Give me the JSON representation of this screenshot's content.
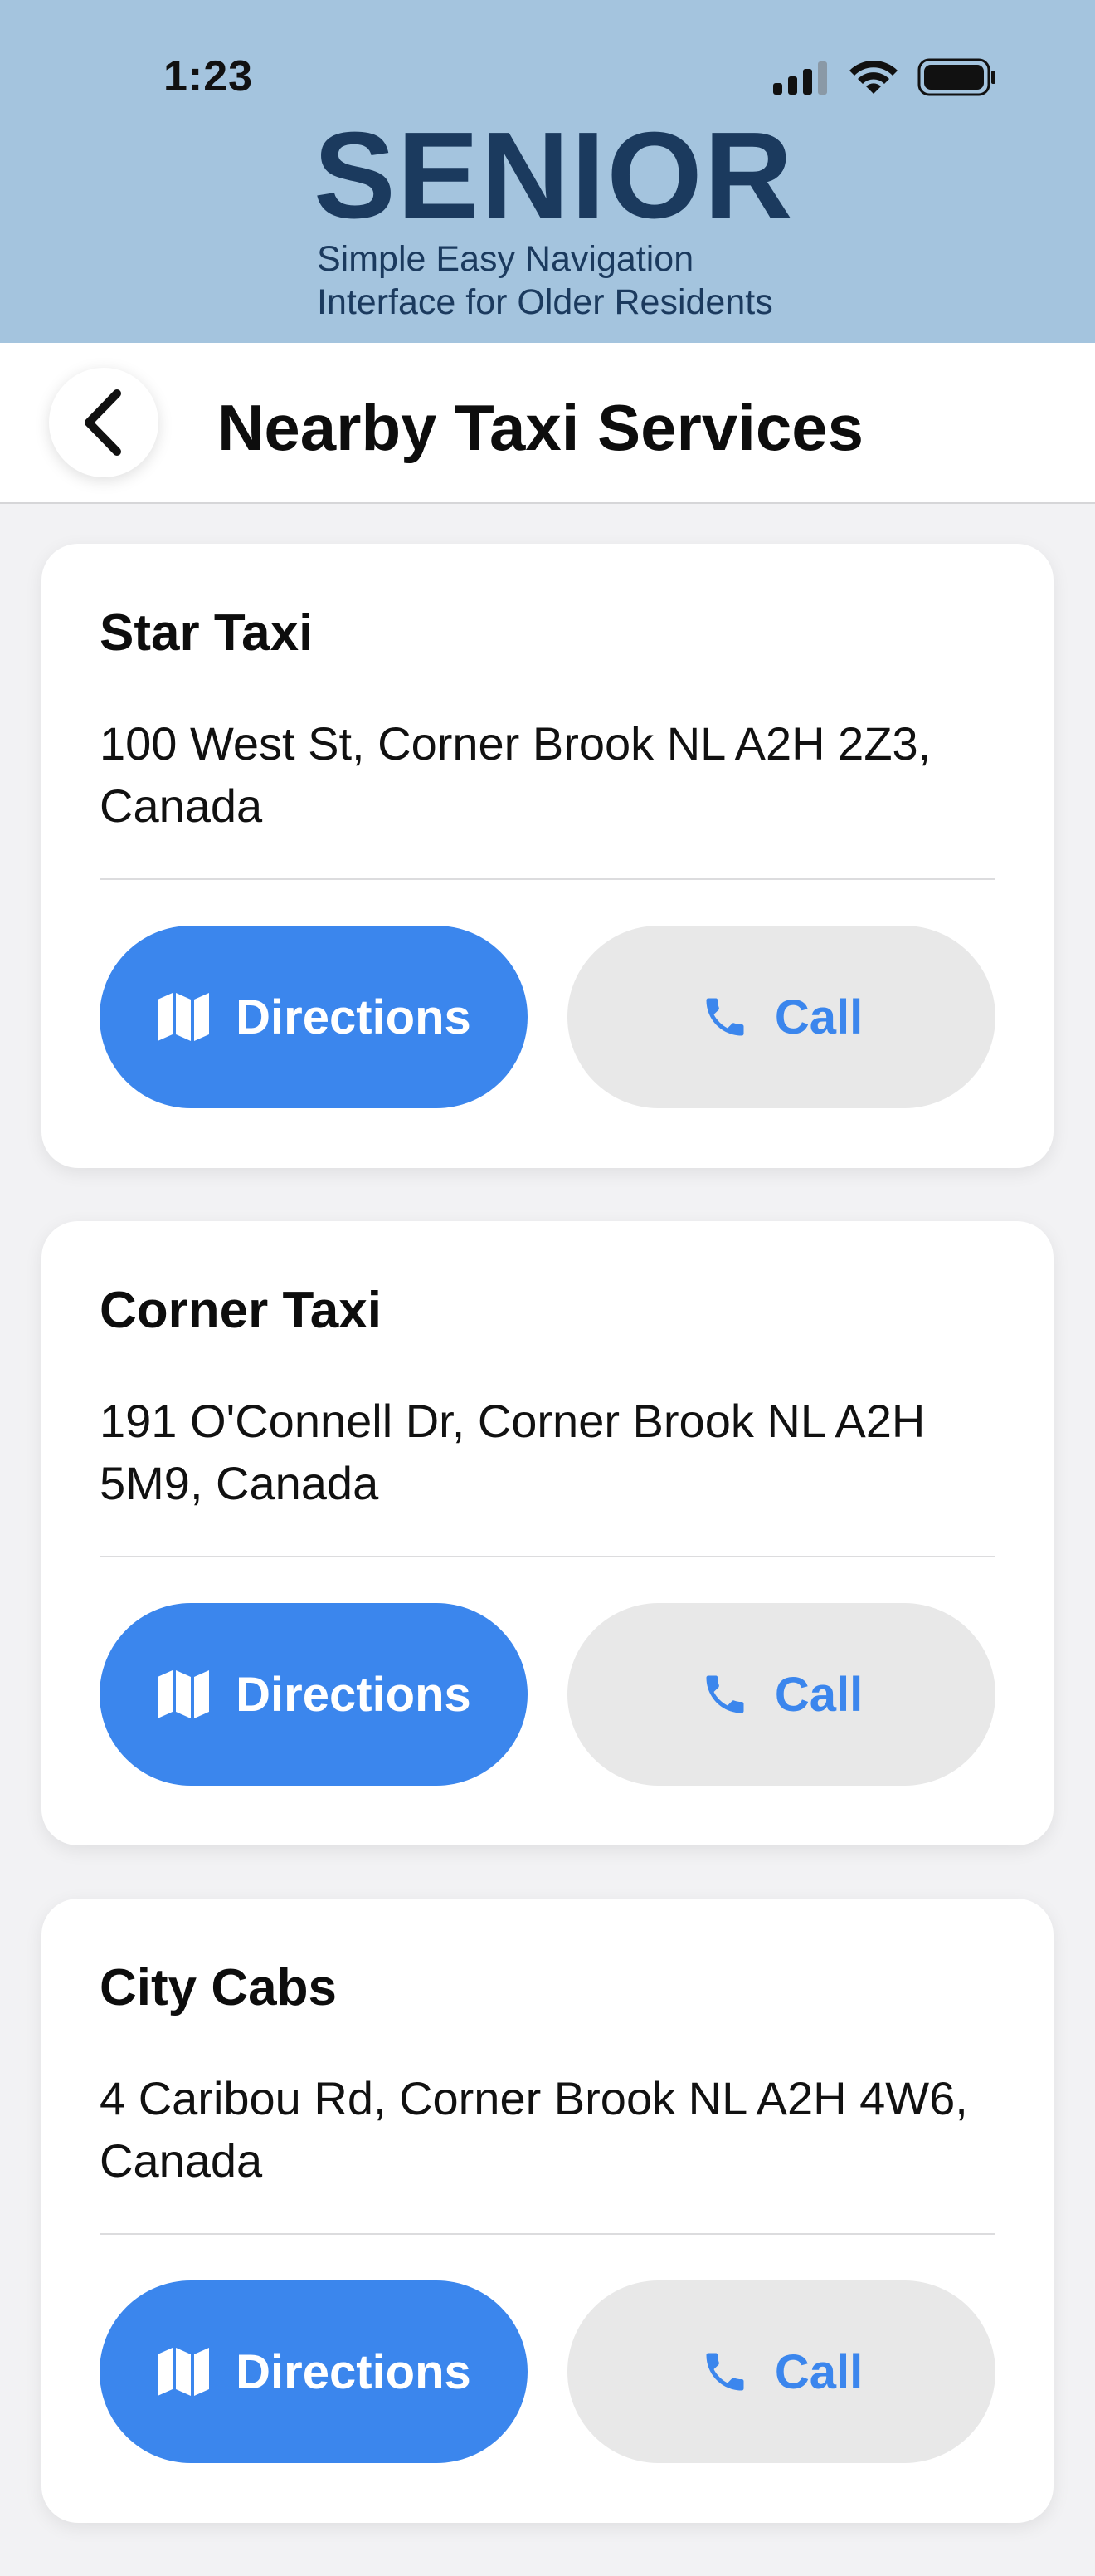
{
  "status_bar": {
    "time": "1:23",
    "icons": [
      "cellular-signal-icon",
      "wifi-icon",
      "battery-icon"
    ]
  },
  "brand": {
    "title": "SENIOR",
    "subtitle_line1": "Simple Easy Navigation",
    "subtitle_line2": "Interface for Older Residents"
  },
  "nav": {
    "title": "Nearby Taxi Services",
    "back_icon": "chevron-left-icon"
  },
  "services": [
    {
      "name": "Star Taxi",
      "address": "100 West St, Corner Brook NL A2H 2Z3, Canada",
      "directions_label": "Directions",
      "call_label": "Call"
    },
    {
      "name": "Corner Taxi",
      "address": "191 O'Connell Dr, Corner Brook NL A2H 5M9, Canada",
      "directions_label": "Directions",
      "call_label": "Call"
    },
    {
      "name": "City Cabs",
      "address": "4 Caribou Rd, Corner Brook NL A2H 4W6, Canada",
      "directions_label": "Directions",
      "call_label": "Call"
    }
  ],
  "colors": {
    "header_bg": "#a4c4de",
    "brand": "#1b3a5e",
    "primary": "#3b86ed",
    "secondary_bg": "#e8e8e8"
  }
}
